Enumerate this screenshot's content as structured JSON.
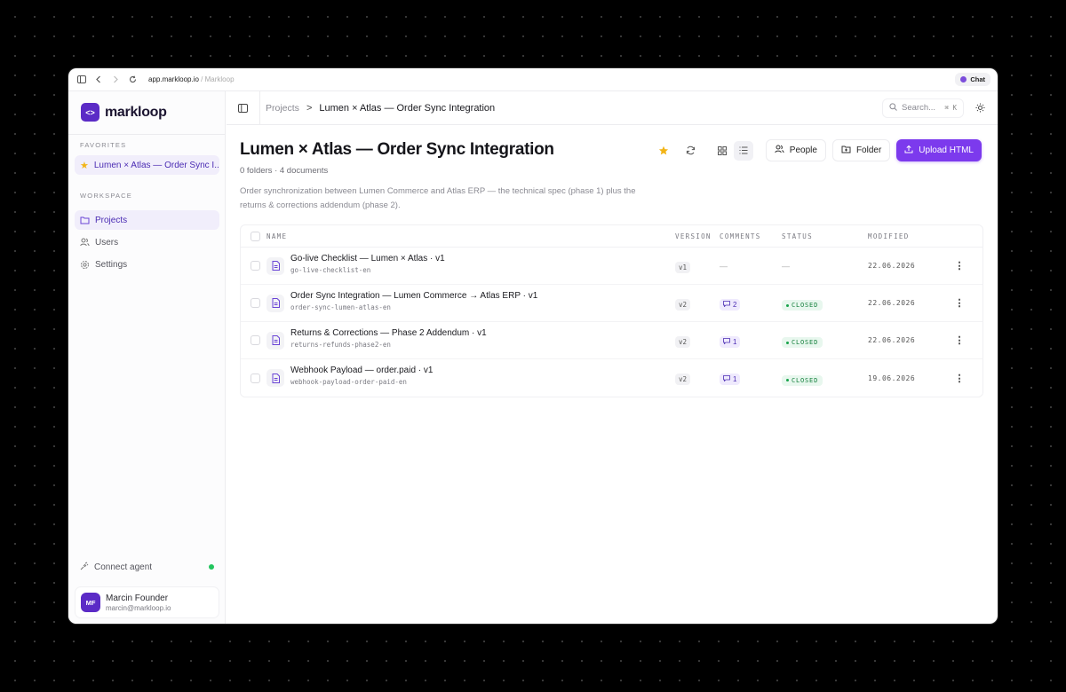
{
  "browser": {
    "url_domain": "app.markloop.io",
    "url_separator": "/",
    "url_page": "Markloop",
    "chat_label": "Chat"
  },
  "sidebar": {
    "brand": "markloop",
    "brand_mark": "<>",
    "favorites_heading": "FAVORITES",
    "favorite_item": "Lumen × Atlas — Order Sync I...",
    "workspace_heading": "WORKSPACE",
    "nav": [
      {
        "label": "Projects",
        "icon": "folder-icon",
        "active": true
      },
      {
        "label": "Users",
        "icon": "users-icon",
        "active": false
      },
      {
        "label": "Settings",
        "icon": "gear-icon",
        "active": false
      }
    ],
    "connect_agent": "Connect agent",
    "user": {
      "initials": "MF",
      "name": "Marcin Founder",
      "email": "marcin@markloop.io"
    }
  },
  "topbar": {
    "breadcrumb_root": "Projects",
    "breadcrumb_sep": ">",
    "breadcrumb_current": "Lumen × Atlas — Order Sync Integration",
    "search_placeholder": "Search...",
    "search_shortcut": "⌘ K"
  },
  "project": {
    "title": "Lumen × Atlas — Order Sync Integration",
    "meta": "0 folders · 4 documents",
    "description": "Order synchronization between Lumen Commerce and Atlas ERP — the technical spec (phase 1) plus the returns & corrections addendum (phase 2)."
  },
  "actions": {
    "people": "People",
    "folder": "Folder",
    "upload": "Upload HTML"
  },
  "table": {
    "headers": {
      "name": "NAME",
      "version": "VERSION",
      "comments": "COMMENTS",
      "status": "STATUS",
      "modified": "MODIFIED"
    },
    "rows": [
      {
        "title": "Go-live Checklist — Lumen × Atlas · v1",
        "slug": "go-live-checklist-en",
        "version": "v1",
        "comments": "—",
        "status": "—",
        "modified": "22.06.2026"
      },
      {
        "title": "Order Sync Integration — Lumen Commerce → Atlas ERP · v1",
        "slug": "order-sync-lumen-atlas-en",
        "version": "v2",
        "comments": "2",
        "status": "CLOSED",
        "modified": "22.06.2026"
      },
      {
        "title": "Returns & Corrections — Phase 2 Addendum · v1",
        "slug": "returns-refunds-phase2-en",
        "version": "v2",
        "comments": "1",
        "status": "CLOSED",
        "modified": "22.06.2026"
      },
      {
        "title": "Webhook Payload — order.paid · v1",
        "slug": "webhook-payload-order-paid-en",
        "version": "v2",
        "comments": "1",
        "status": "CLOSED",
        "modified": "19.06.2026"
      }
    ]
  },
  "colors": {
    "brand": "#5b2bc6",
    "primary_button": "#7c3aed",
    "favorite_star": "#f2b416",
    "status_closed": "#15803d",
    "online_dot": "#22c55e"
  }
}
